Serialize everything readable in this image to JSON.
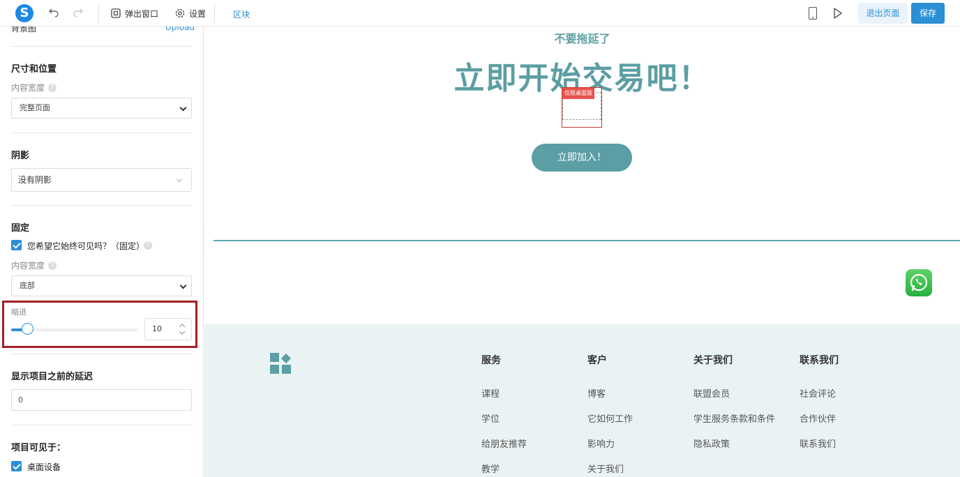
{
  "topbar": {
    "logo_letter": "S",
    "popup_label": "弹出窗口",
    "settings_label": "设置",
    "block_label": "区块",
    "exit_label": "退出页面",
    "save_label": "保存"
  },
  "panel": {
    "background_label": "背景图",
    "upload_label": "Upload",
    "size_section": {
      "title": "尺寸和位置",
      "content_width_label": "内容宽度",
      "content_width_value": "完整页面"
    },
    "shadow_section": {
      "title": "阴影",
      "value": "没有阴影"
    },
    "fixed_section": {
      "title": "固定",
      "checkbox_label": "您希望它始终可见吗？（固定）",
      "checkbox_checked": true,
      "content_width_label": "内容宽度",
      "position_value": "底部"
    },
    "indent_section": {
      "label": "缩进",
      "value": "10",
      "slider_fraction": 0.09
    },
    "delay_section": {
      "title": "显示项目之前的延迟",
      "value": "0"
    },
    "visible_section": {
      "title": "项目可见于：",
      "desktop_label": "桌面设备",
      "desktop_checked": true
    }
  },
  "canvas": {
    "subhead": "不要拖延了",
    "headline": "立即开始交易吧！",
    "desktop_only_tag": "仅限桌面版",
    "join_button": "立即加入！",
    "footer": {
      "columns": [
        {
          "title": "服务",
          "items": [
            "课程",
            "学位",
            "给朋友推荐",
            "教学"
          ]
        },
        {
          "title": "客户",
          "items": [
            "博客",
            "它如何工作",
            "影响力",
            "关于我们"
          ]
        },
        {
          "title": "关于我们",
          "items": [
            "联盟会员",
            "学生服务条款和条件",
            "隐私政策"
          ]
        },
        {
          "title": "联系我们",
          "items": [
            "社会评论",
            "合作伙伴",
            "联系我们"
          ]
        }
      ]
    }
  },
  "colors": {
    "accent": "#2b8fd6",
    "teal": "#5b9ea3",
    "highlight": "#a31f24"
  }
}
